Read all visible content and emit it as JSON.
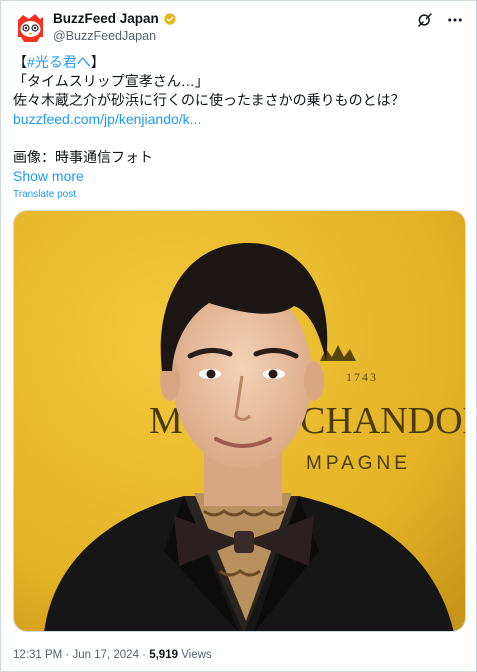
{
  "author": {
    "display_name": "BuzzFeed Japan",
    "handle": "@BuzzFeedJapan",
    "verified_badge_color": "#e2b719",
    "avatar_icon": "buzzfeed-logo-icon"
  },
  "header_actions": {
    "grok_icon": "grok-icon",
    "more_icon": "more-options-icon"
  },
  "text": {
    "hashtag_open": "【",
    "hashtag": "#光る君へ",
    "hashtag_close": "】",
    "line2": "「タイムスリップ宣孝さん…」",
    "line3": "佐々木蔵之介が砂浜に行くのに使ったまさかの乗りものとは？",
    "link": "buzzfeed.com/jp/kenjiando/k...",
    "line5": "画像：時事通信フォト"
  },
  "show_more": "Show more",
  "translate": "Translate post",
  "photo": {
    "backdrop_text_year": "1743",
    "backdrop_text_brand_left": "M",
    "backdrop_text_brand_right": "CHANDON",
    "backdrop_text_sub": "MPAGNE",
    "background_color": "#e8ba2a"
  },
  "footer": {
    "time": "12:31 PM",
    "sep1": " · ",
    "date": "Jun 17, 2024",
    "sep2": " · ",
    "views_count": "5,919",
    "views_label": " Views"
  },
  "colors": {
    "accent": "#1d9bf0",
    "secondary_text": "#536471"
  }
}
